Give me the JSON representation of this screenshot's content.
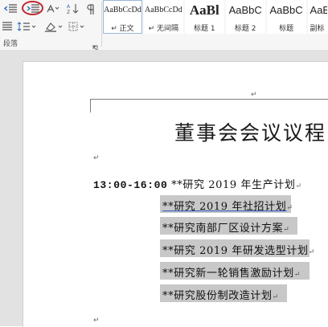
{
  "ribbon": {
    "group_label": "段落",
    "styles": [
      {
        "preview": "AaBbCcDd",
        "name": "↵ 正文",
        "size": "small"
      },
      {
        "preview": "AaBbCcDd",
        "name": "↵ 无间隔",
        "size": "small"
      },
      {
        "preview": "AaBl",
        "name": "标题 1",
        "size": "big"
      },
      {
        "preview": "AaBbC",
        "name": "标题 2",
        "size": "mid"
      },
      {
        "preview": "AaBbC",
        "name": "标题",
        "size": "mid"
      },
      {
        "preview": "AaBbC",
        "name": "副标",
        "size": "mid"
      }
    ]
  },
  "document": {
    "title": "董事会会议议程",
    "first_line": {
      "time": "13:00-16:00",
      "text": "**研究 2019 年生产计划"
    },
    "selected_lines": [
      "**研究 2019 年社招计划",
      "**研究南部厂区设计方案",
      "**研究 2019 年研发选型计划",
      "**研究新一轮销售激励计划",
      "**研究股份制改造计划"
    ],
    "paragraph_mark": "↵"
  },
  "colors": {
    "annotation_circle": "#c0282d",
    "selection": "#c8c8c8",
    "ribbon": "#f6f6f6"
  }
}
